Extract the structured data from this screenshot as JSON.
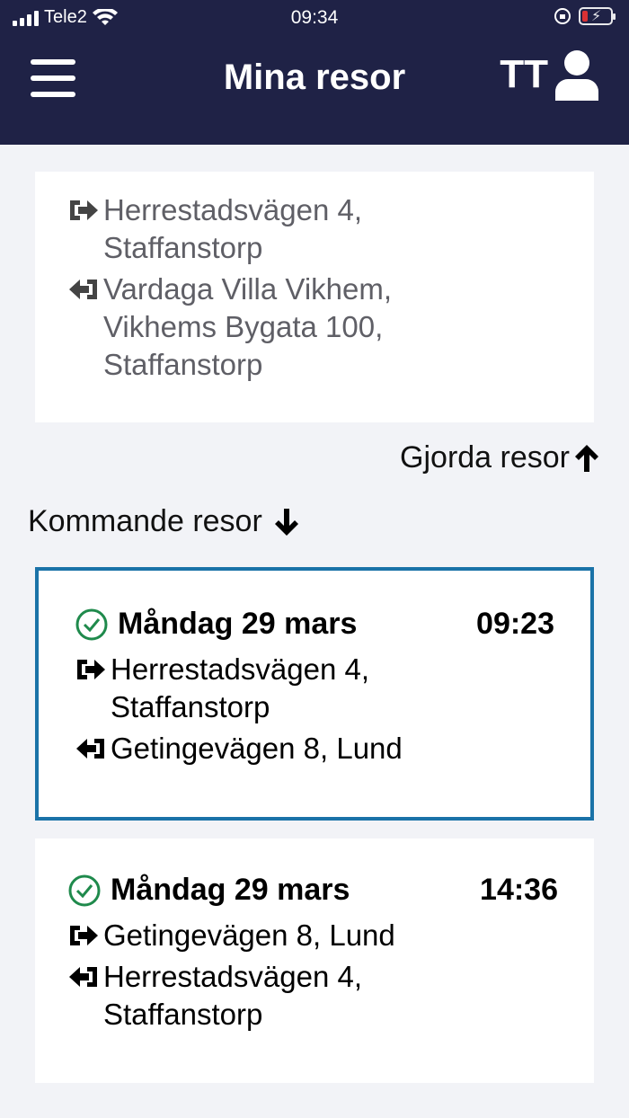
{
  "status_bar": {
    "carrier": "Tele2",
    "time": "09:34"
  },
  "header": {
    "title": "Mina resor",
    "user_initials": "TT"
  },
  "past_trip": {
    "pickup": [
      "Herrestadsvägen 4,",
      "Staffanstorp"
    ],
    "dropoff": [
      "Vardaga Villa Vikhem,",
      "Vikhems Bygata 100,",
      "Staffanstorp"
    ]
  },
  "links": {
    "done_trips": "Gjorda resor",
    "upcoming_trips": "Kommande resor"
  },
  "trips": [
    {
      "date": "Måndag 29 mars",
      "time": "09:23",
      "pickup": [
        "Herrestadsvägen 4,",
        "Staffanstorp"
      ],
      "dropoff": [
        "Getingevägen 8, Lund"
      ]
    },
    {
      "date": "Måndag 29 mars",
      "time": "14:36",
      "pickup": [
        "Getingevägen 8, Lund"
      ],
      "dropoff": [
        "Herrestadsvägen 4,",
        "Staffanstorp"
      ]
    }
  ],
  "colors": {
    "header_bg": "#1f2246",
    "selected_border": "#1a72a8",
    "status_ok": "#1f8a4c"
  }
}
